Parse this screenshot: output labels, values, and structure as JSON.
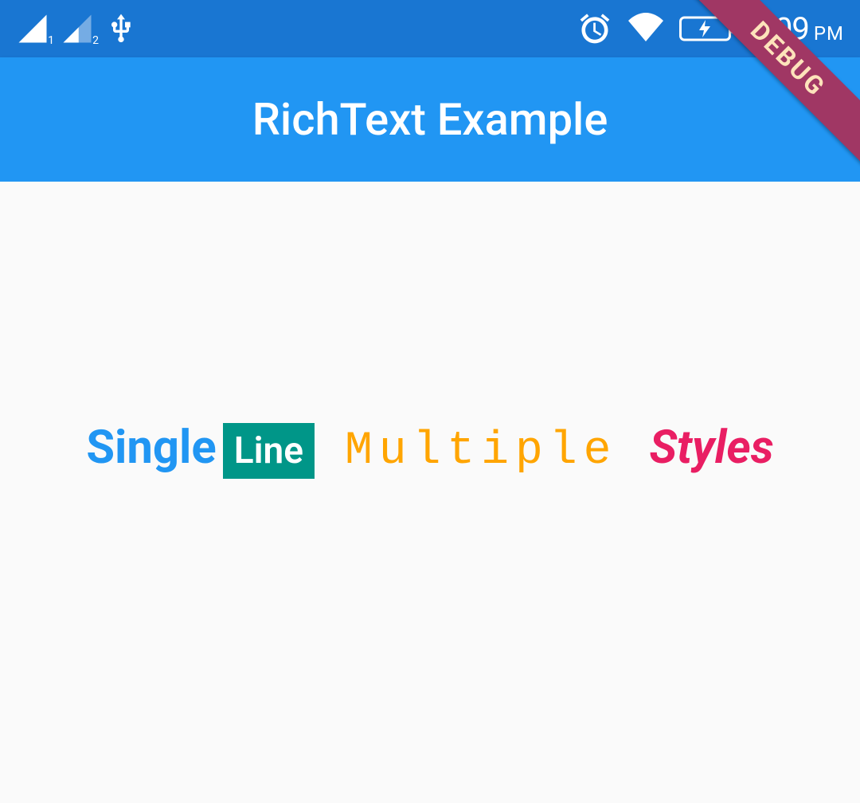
{
  "statusBar": {
    "signal1_sub": "1",
    "signal2_sub": "2",
    "time": "7:09",
    "ampm": "PM"
  },
  "appBar": {
    "title": "RichText Example"
  },
  "debug": {
    "label": "DEBUG"
  },
  "content": {
    "seg1": "Single",
    "seg2": "Line",
    "seg3": "Multiple",
    "seg4": "Styles"
  }
}
